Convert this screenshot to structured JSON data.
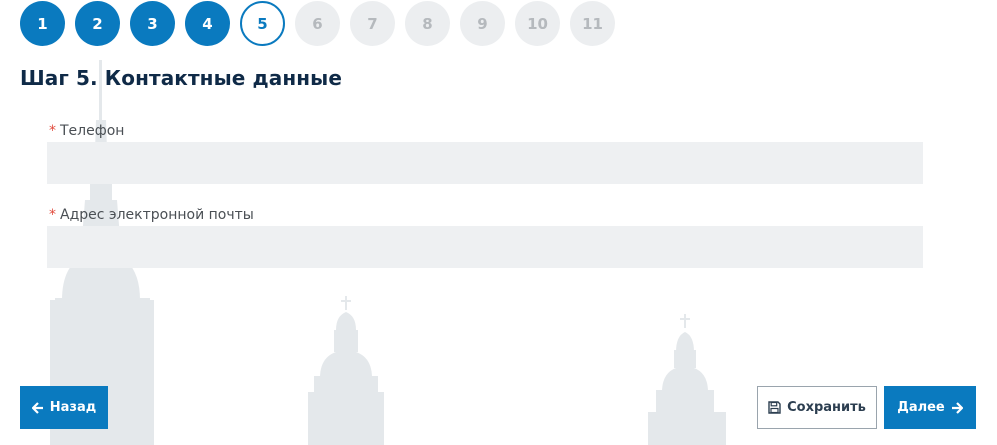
{
  "stepper": {
    "steps": [
      {
        "label": "1",
        "state": "done"
      },
      {
        "label": "2",
        "state": "done"
      },
      {
        "label": "3",
        "state": "done"
      },
      {
        "label": "4",
        "state": "done"
      },
      {
        "label": "5",
        "state": "current"
      },
      {
        "label": "6",
        "state": "todo"
      },
      {
        "label": "7",
        "state": "todo"
      },
      {
        "label": "8",
        "state": "todo"
      },
      {
        "label": "9",
        "state": "todo"
      },
      {
        "label": "10",
        "state": "todo"
      },
      {
        "label": "11",
        "state": "todo"
      }
    ]
  },
  "form": {
    "title": "Шаг 5. Контактные данные",
    "required_mark": "*",
    "phone": {
      "label": "Телефон",
      "value": ""
    },
    "email": {
      "label": "Адрес электронной почты",
      "value": ""
    }
  },
  "actions": {
    "back_label": "Назад",
    "save_label": "Сохранить",
    "next_label": "Далее"
  },
  "icons": {
    "back": "arrow-left-icon",
    "save": "floppy-disk-icon",
    "next": "arrow-right-icon"
  },
  "colors": {
    "accent": "#0a7abf",
    "title": "#0f2a47",
    "required": "#e14a3c",
    "step_inactive_bg": "#eceef0",
    "step_inactive_text": "#b5b9bd",
    "input_bg": "#eef0f2",
    "watermark": "#e3e7ea"
  }
}
